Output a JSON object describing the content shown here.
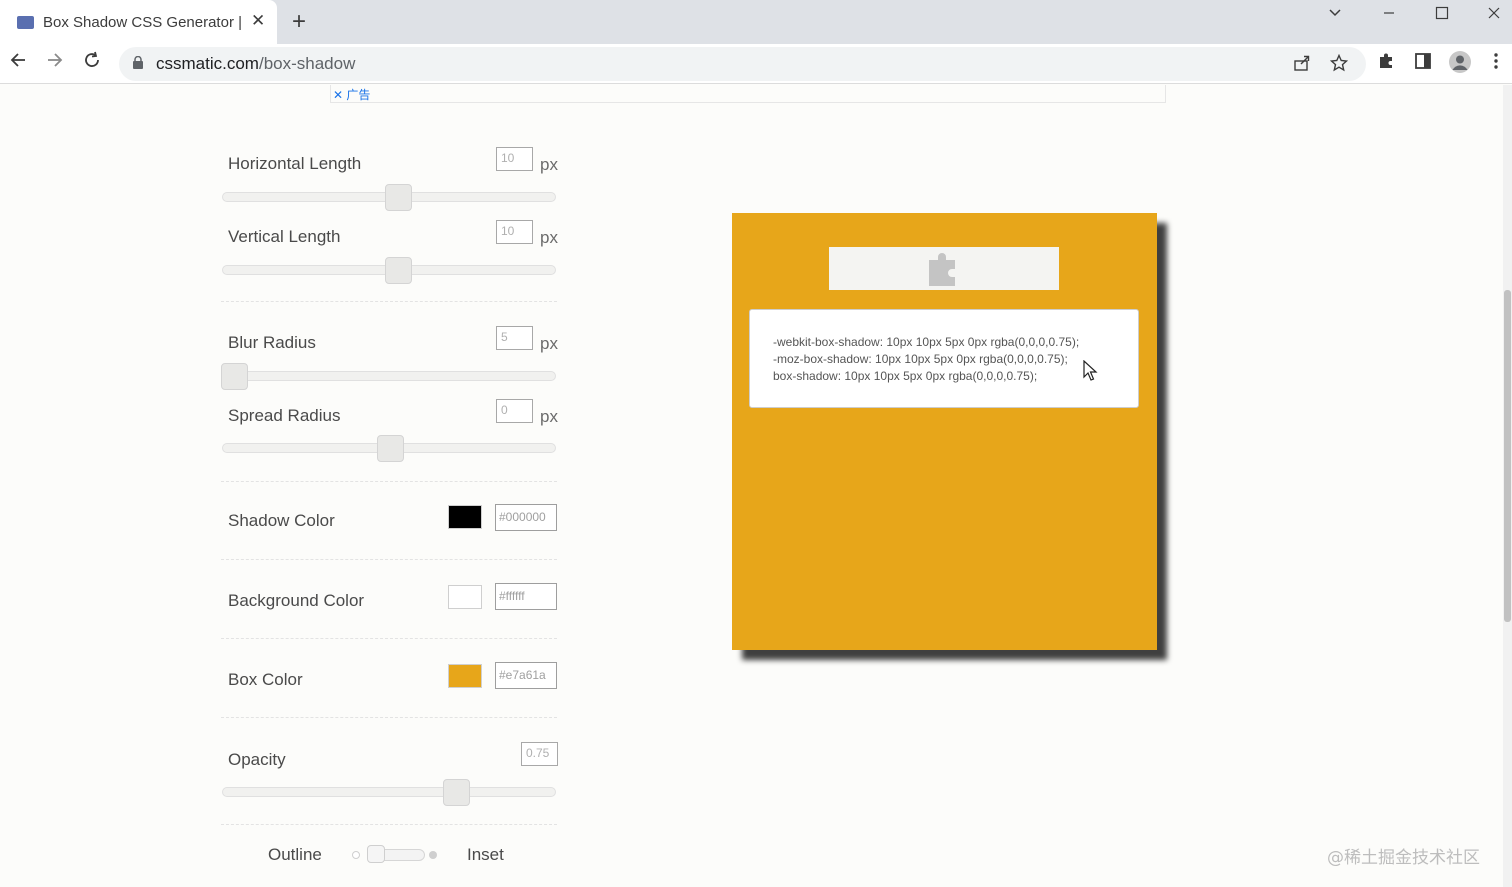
{
  "browser": {
    "tab_title": "Box Shadow CSS Generator | CSSmatic",
    "tab_close": "✕",
    "new_tab": "+",
    "url_host": "cssmatic.com",
    "url_path": "/box-shadow"
  },
  "ad": {
    "label": "✕ 广告"
  },
  "controls": {
    "horizontal": {
      "label": "Horizontal Length",
      "value": "10",
      "unit": "px"
    },
    "vertical": {
      "label": "Vertical Length",
      "value": "10",
      "unit": "px"
    },
    "blur": {
      "label": "Blur Radius",
      "value": "5",
      "unit": "px"
    },
    "spread": {
      "label": "Spread Radius",
      "value": "0",
      "unit": "px"
    },
    "shadow_color": {
      "label": "Shadow Color",
      "hex": "#000000"
    },
    "background_color": {
      "label": "Background Color",
      "hex": "#ffffff"
    },
    "box_color": {
      "label": "Box Color",
      "hex": "#e7a61a"
    },
    "opacity": {
      "label": "Opacity",
      "value": "0.75"
    },
    "outline_label": "Outline",
    "inset_label": "Inset"
  },
  "preview": {
    "box_color": "#e7a61a",
    "code_lines": [
      "-webkit-box-shadow: 10px 10px 5px 0px rgba(0,0,0,0.75);",
      "-moz-box-shadow: 10px 10px 5px 0px rgba(0,0,0,0.75);",
      "box-shadow: 10px 10px 5px 0px rgba(0,0,0,0.75);"
    ]
  },
  "watermark": "@稀土掘金技术社区"
}
